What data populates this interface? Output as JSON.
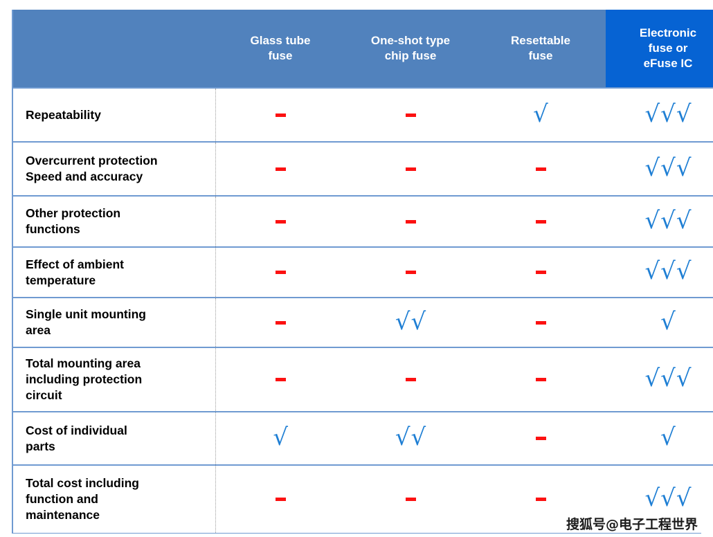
{
  "table": {
    "label_column_header": "",
    "columns": [
      {
        "label": "Glass tube\nfuse",
        "highlighted": false
      },
      {
        "label": "One-shot type\nchip fuse",
        "highlighted": false
      },
      {
        "label": "Resettable\nfuse",
        "highlighted": false
      },
      {
        "label": "Electronic\nfuse or\neFuse IC",
        "highlighted": true
      }
    ],
    "rows": [
      {
        "label": "Repeatability",
        "ratings": [
          {
            "symbol": "dash",
            "count": 1
          },
          {
            "symbol": "dash",
            "count": 1
          },
          {
            "symbol": "check",
            "count": 1
          },
          {
            "symbol": "check",
            "count": 3
          }
        ]
      },
      {
        "label": "Overcurrent protection\nSpeed and accuracy",
        "ratings": [
          {
            "symbol": "dash",
            "count": 1
          },
          {
            "symbol": "dash",
            "count": 1
          },
          {
            "symbol": "dash",
            "count": 1
          },
          {
            "symbol": "check",
            "count": 3
          }
        ]
      },
      {
        "label": "Other protection\nfunctions",
        "ratings": [
          {
            "symbol": "dash",
            "count": 1
          },
          {
            "symbol": "dash",
            "count": 1
          },
          {
            "symbol": "dash",
            "count": 1
          },
          {
            "symbol": "check",
            "count": 3
          }
        ]
      },
      {
        "label": "Effect of ambient\ntemperature",
        "ratings": [
          {
            "symbol": "dash",
            "count": 1
          },
          {
            "symbol": "dash",
            "count": 1
          },
          {
            "symbol": "dash",
            "count": 1
          },
          {
            "symbol": "check",
            "count": 3
          }
        ]
      },
      {
        "label": "Single unit mounting\narea",
        "ratings": [
          {
            "symbol": "dash",
            "count": 1
          },
          {
            "symbol": "check",
            "count": 2
          },
          {
            "symbol": "dash",
            "count": 1
          },
          {
            "symbol": "check",
            "count": 1
          }
        ]
      },
      {
        "label": "Total mounting area\nincluding protection\ncircuit",
        "ratings": [
          {
            "symbol": "dash",
            "count": 1
          },
          {
            "symbol": "dash",
            "count": 1
          },
          {
            "symbol": "dash",
            "count": 1
          },
          {
            "symbol": "check",
            "count": 3
          }
        ]
      },
      {
        "label": "Cost of individual\nparts",
        "ratings": [
          {
            "symbol": "check",
            "count": 1
          },
          {
            "symbol": "check",
            "count": 2
          },
          {
            "symbol": "dash",
            "count": 1
          },
          {
            "symbol": "check",
            "count": 1
          }
        ]
      },
      {
        "label": "Total cost including\nfunction and\nmaintenance",
        "ratings": [
          {
            "symbol": "dash",
            "count": 1
          },
          {
            "symbol": "dash",
            "count": 1
          },
          {
            "symbol": "dash",
            "count": 1
          },
          {
            "symbol": "check",
            "count": 3
          }
        ]
      }
    ]
  },
  "watermark": {
    "text": "搜狐号@电子工程世界"
  },
  "symbols": {
    "check_glyph": "√",
    "dash_glyph": "-"
  },
  "colors": {
    "header_blue": "#5182bd",
    "highlight_blue": "#0663d3",
    "check_blue": "#1f7fd4",
    "dash_red": "#fc1111",
    "border_blue": "#6f9ad1",
    "divider_gray": "#9a9a9a"
  }
}
